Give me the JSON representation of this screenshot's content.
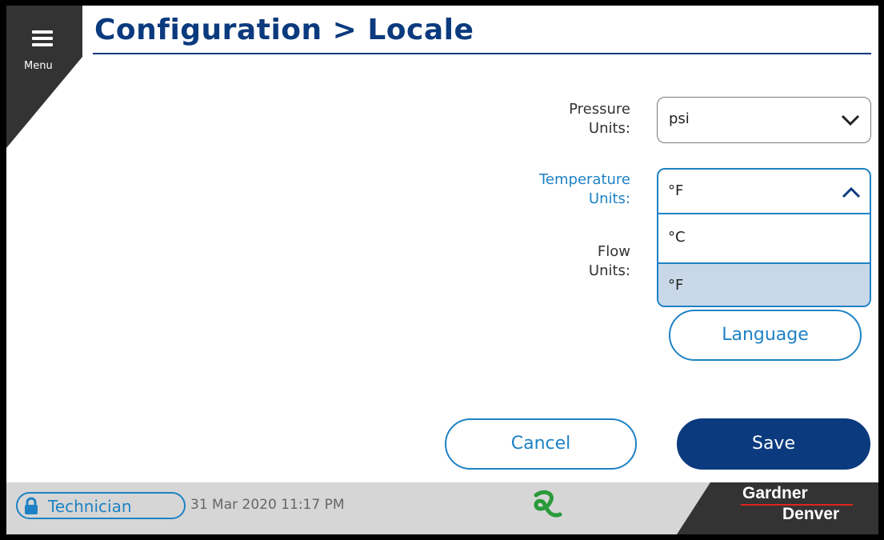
{
  "header": {
    "menu_label": "Menu",
    "title": "Configuration > Locale"
  },
  "form": {
    "pressure": {
      "label_line1": "Pressure",
      "label_line2": "Units:",
      "value": "psi"
    },
    "temperature": {
      "label_line1": "Temperature",
      "label_line2": "Units:",
      "value": "°F",
      "options": [
        "°C",
        "°F"
      ],
      "selected": "°F"
    },
    "flow": {
      "label_line1": "Flow",
      "label_line2": "Units:"
    },
    "language_label": "Language"
  },
  "actions": {
    "cancel_label": "Cancel",
    "save_label": "Save"
  },
  "statusbar": {
    "user_role": "Technician",
    "datetime": "31 Mar 2020  11:17 PM",
    "brand_line1": "Gardner",
    "brand_line2": "Denver"
  },
  "colors": {
    "primary": "#0b3a7e",
    "accent": "#1e82c4",
    "selected_row": "#c8d8e8",
    "status_icon": "#2a9a3a",
    "brand_red": "#e2231a"
  }
}
